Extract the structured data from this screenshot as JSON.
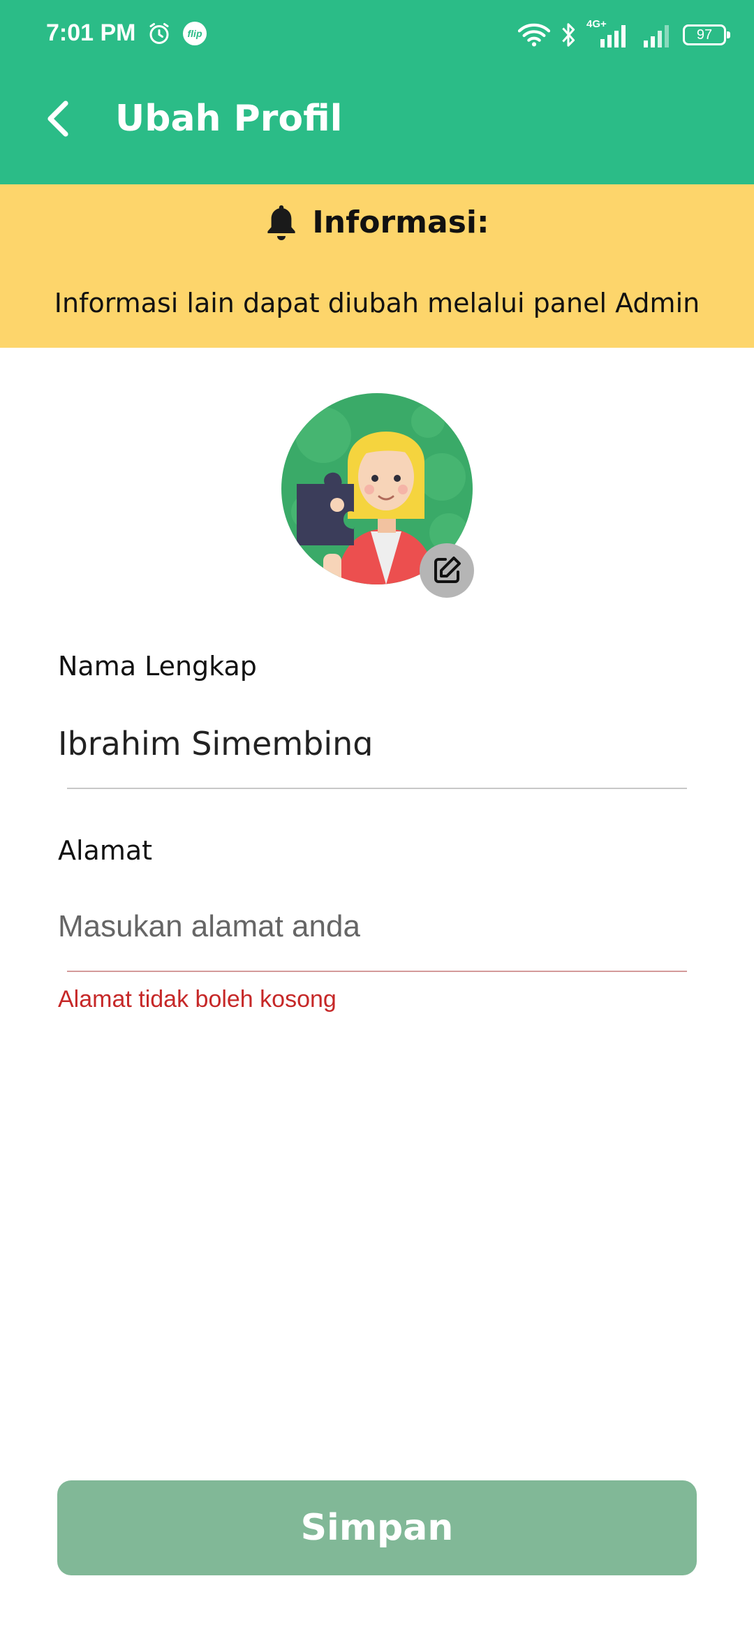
{
  "status_bar": {
    "time": "7:01 PM",
    "flip_label": "flip",
    "battery": "97",
    "network_label": "4G+"
  },
  "app_bar": {
    "title": "Ubah Profil"
  },
  "info_banner": {
    "title": "Informasi:",
    "message": "Informasi lain dapat diubah melalui panel Admin"
  },
  "form": {
    "name_label": "Nama Lengkap",
    "name_value": "Ibrahim Simembing",
    "address_label": "Alamat",
    "address_placeholder": "Masukan alamat anda",
    "address_value": "",
    "address_error": "Alamat tidak boleh kosong"
  },
  "save_button": {
    "label": "Simpan"
  },
  "colors": {
    "primary": "#2bbc87",
    "banner": "#fdd56b",
    "button_disabled": "#81b897",
    "error": "#c62828"
  },
  "icons": [
    "alarm-icon",
    "flip-icon",
    "wifi-icon",
    "bluetooth-icon",
    "signal-icon",
    "battery-icon",
    "back-arrow-icon",
    "bell-icon",
    "edit-icon"
  ]
}
